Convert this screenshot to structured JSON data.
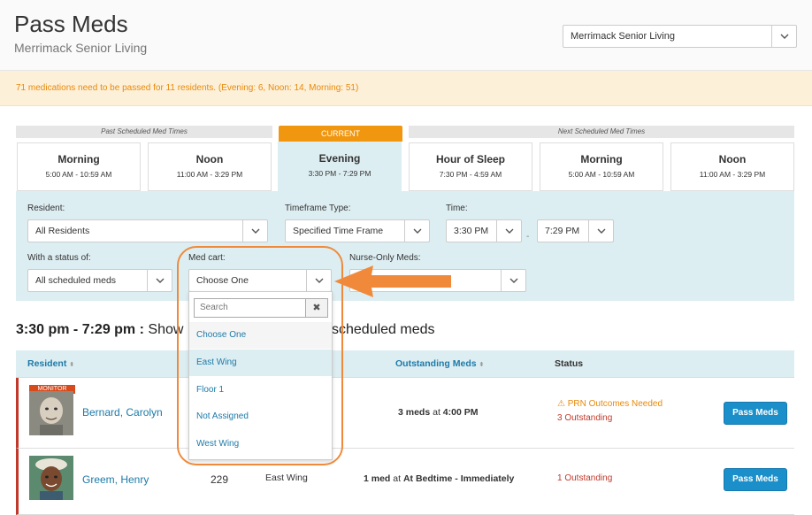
{
  "header": {
    "title": "Pass Meds",
    "subtitle": "Merrimack Senior Living",
    "facility_select": "Merrimack Senior Living"
  },
  "alert": "71 medications need to be passed for 11 residents. (Evening: 6, Noon: 14, Morning: 51)",
  "timeframes": {
    "past_label": "Past Scheduled Med Times",
    "current_label": "CURRENT",
    "next_label": "Next Scheduled Med Times",
    "items": [
      {
        "name": "Morning",
        "time": "5:00 AM - 10:59 AM"
      },
      {
        "name": "Noon",
        "time": "11:00 AM - 3:29 PM"
      },
      {
        "name": "Evening",
        "time": "3:30 PM - 7:29 PM"
      },
      {
        "name": "Hour of Sleep",
        "time": "7:30 PM - 4:59 AM"
      },
      {
        "name": "Morning",
        "time": "5:00 AM - 10:59 AM"
      },
      {
        "name": "Noon",
        "time": "11:00 AM - 3:29 PM"
      }
    ]
  },
  "filters": {
    "resident_label": "Resident:",
    "resident_value": "All Residents",
    "timeframe_type_label": "Timeframe Type:",
    "timeframe_type_value": "Specified Time Frame",
    "time_label": "Time:",
    "time_start": "3:30 PM",
    "time_end": "7:29 PM",
    "time_separator": "-",
    "status_label": "With a status of:",
    "status_value": "All scheduled meds",
    "medcart_label": "Med cart:",
    "medcart_value": "Choose One",
    "nurse_label": "Nurse-Only Meds:"
  },
  "dropdown": {
    "search_placeholder": "Search",
    "clear_symbol": "✖",
    "options": [
      "Choose One",
      "East Wing",
      "Floor 1",
      "Not Assigned",
      "West Wing"
    ]
  },
  "heading": {
    "range": "3:30 pm - 7:29 pm :",
    "show_text": "Show",
    "scheduled_text": "scheduled meds"
  },
  "table": {
    "col_resident": "Resident",
    "col_outstanding": "Outstanding Meds",
    "col_status": "Status",
    "sort_symbol": "⬍",
    "rows": [
      {
        "monitor": "MONITOR",
        "name": "Bernard, Carolyn",
        "room": "",
        "cart": "",
        "meds_count": "3 meds",
        "meds_mid": " at ",
        "meds_time": "4:00 PM",
        "status_warning": "PRN Outcomes Needed",
        "status_outstanding": "3 Outstanding",
        "button": "Pass Meds"
      },
      {
        "name": "Greem, Henry",
        "room": "229",
        "cart": "East Wing",
        "meds_count": "1 med",
        "meds_mid": " at ",
        "meds_time": "At Bedtime - Immediately",
        "status_outstanding": "1 Outstanding",
        "button": "Pass Meds"
      }
    ]
  },
  "colors": {
    "accent_blue": "#1d7aa8",
    "current_orange": "#f0960f",
    "alert_text": "#e8890c",
    "danger": "#c0392b",
    "button_blue": "#1a8fc9",
    "annotation_orange": "#f08a3a"
  }
}
